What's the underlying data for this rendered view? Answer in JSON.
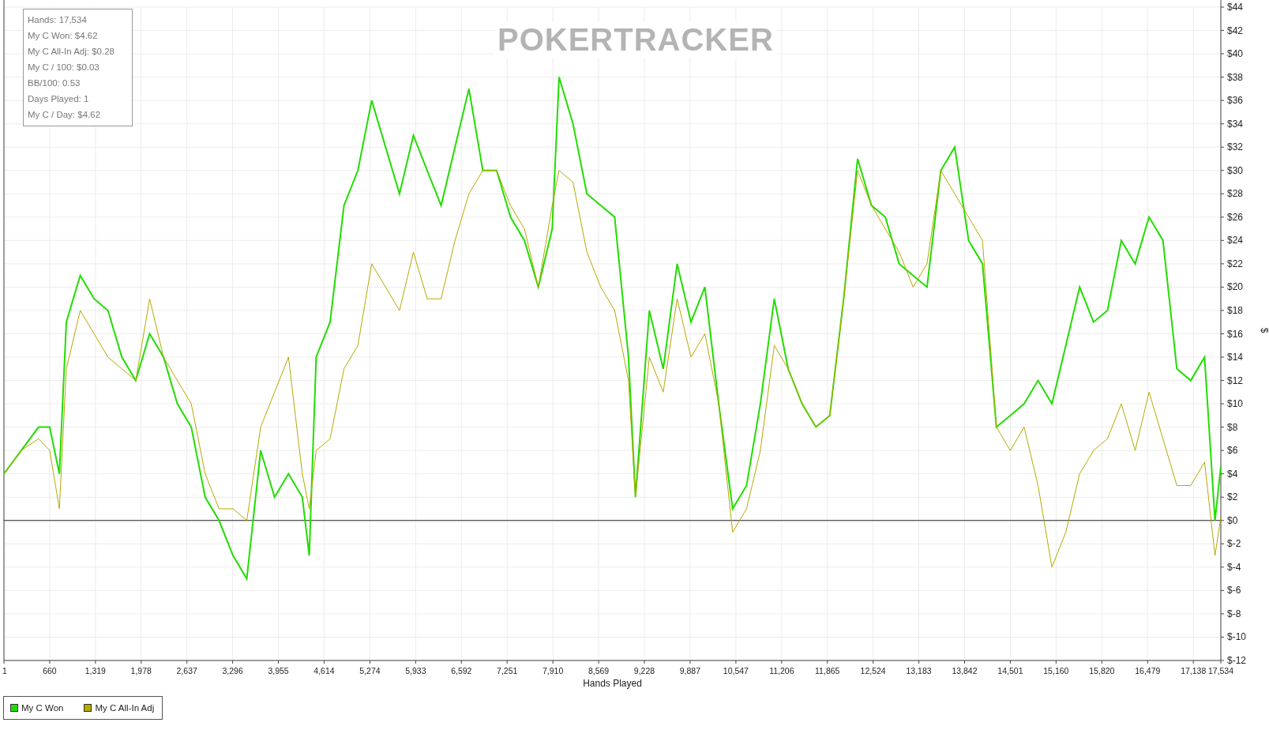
{
  "watermark": "POKERTRACKER",
  "stats_box": [
    "Hands: 17,534",
    "My C Won: $4.62",
    "My C All-In Adj: $0.28",
    "My C / 100: $0.03",
    "BB/100: 0.53",
    "Days Played: 1",
    "My C / Day: $4.62"
  ],
  "chart_data": {
    "type": "line",
    "grid": true,
    "xlabel": "Hands Played",
    "ylabel": "$",
    "x": [
      1,
      250,
      500,
      660,
      800,
      900,
      1100,
      1300,
      1500,
      1700,
      1900,
      2100,
      2300,
      2500,
      2700,
      2900,
      3100,
      3300,
      3500,
      3700,
      3900,
      4100,
      4300,
      4400,
      4500,
      4700,
      4900,
      5100,
      5300,
      5500,
      5700,
      5900,
      6100,
      6300,
      6500,
      6700,
      6900,
      7100,
      7300,
      7500,
      7700,
      7900,
      8000,
      8200,
      8400,
      8600,
      8800,
      9000,
      9100,
      9300,
      9500,
      9700,
      9900,
      10100,
      10300,
      10500,
      10700,
      10900,
      11100,
      11300,
      11500,
      11700,
      11900,
      12100,
      12300,
      12500,
      12700,
      12900,
      13100,
      13300,
      13500,
      13700,
      13900,
      14100,
      14300,
      14500,
      14700,
      14900,
      15100,
      15300,
      15500,
      15700,
      15900,
      16100,
      16300,
      16500,
      16700,
      16900,
      17100,
      17300,
      17450,
      17534
    ],
    "series": [
      {
        "name": "My C Won",
        "color": "#22dd00",
        "values": [
          4,
          6,
          8,
          8,
          4,
          17,
          21,
          19,
          18,
          14,
          12,
          16,
          14,
          10,
          8,
          2,
          0,
          -3,
          -5,
          6,
          2,
          4,
          2,
          -3,
          14,
          17,
          27,
          30,
          36,
          32,
          28,
          33,
          30,
          27,
          32,
          37,
          30,
          30,
          26,
          24,
          20,
          25,
          38,
          34,
          28,
          27,
          26,
          14,
          2,
          18,
          13,
          22,
          17,
          20,
          10,
          1,
          3,
          10,
          19,
          13,
          10,
          8,
          9,
          19,
          31,
          27,
          26,
          22,
          21,
          20,
          30,
          32,
          24,
          22,
          8,
          9,
          10,
          12,
          10,
          15,
          20,
          17,
          18,
          24,
          22,
          26,
          24,
          13,
          12,
          14,
          0,
          4.62
        ]
      },
      {
        "name": "My C All-In Adj",
        "color": "#b8a800",
        "values": [
          4,
          6,
          7,
          6,
          1,
          13,
          18,
          16,
          14,
          13,
          12,
          19,
          14,
          12,
          10,
          4,
          1,
          1,
          0,
          8,
          11,
          14,
          4,
          1,
          6,
          7,
          13,
          15,
          22,
          20,
          18,
          23,
          19,
          19,
          24,
          28,
          30,
          30,
          27,
          25,
          20,
          27,
          30,
          29,
          23,
          20,
          18,
          12,
          2,
          14,
          11,
          19,
          14,
          16,
          10,
          -1,
          1,
          6,
          15,
          13,
          10,
          8,
          9,
          19,
          30,
          27,
          25,
          23,
          20,
          22,
          30,
          28,
          26,
          24,
          8,
          6,
          8,
          3,
          -4,
          -1,
          4,
          6,
          7,
          10,
          6,
          11,
          7,
          3,
          3,
          5,
          -3,
          0.28
        ]
      }
    ],
    "xlim": [
      1,
      17534
    ],
    "ylim": [
      -12,
      44
    ],
    "xticks": [
      1,
      660,
      {
        "value": 1319,
        "label": "1,319"
      },
      {
        "value": 1978,
        "label": "1,978"
      },
      {
        "value": 2637,
        "label": "2,637"
      },
      {
        "value": 3296,
        "label": "3,296"
      },
      {
        "value": 3955,
        "label": "3,955"
      },
      {
        "value": 4614,
        "label": "4,614"
      },
      {
        "value": 5274,
        "label": "5,274"
      },
      {
        "value": 5933,
        "label": "5,933"
      },
      {
        "value": 6592,
        "label": "6,592"
      },
      {
        "value": 7251,
        "label": "7,251"
      },
      {
        "value": 7910,
        "label": "7,910"
      },
      {
        "value": 8569,
        "label": "8,569"
      },
      {
        "value": 9228,
        "label": "9,228"
      },
      {
        "value": 9887,
        "label": "9,887"
      },
      {
        "value": 10547,
        "label": "10,547"
      },
      {
        "value": 11206,
        "label": "11,206"
      },
      {
        "value": 11865,
        "label": "11,865"
      },
      {
        "value": 12524,
        "label": "12,524"
      },
      {
        "value": 13183,
        "label": "13,183"
      },
      {
        "value": 13842,
        "label": "13,842"
      },
      {
        "value": 14501,
        "label": "14,501"
      },
      {
        "value": 15160,
        "label": "15,160"
      },
      {
        "value": 15820,
        "label": "15,820"
      },
      {
        "value": 16479,
        "label": "16,479"
      },
      {
        "value": 17138,
        "label": "17,138"
      },
      {
        "value": 17534,
        "label": "17,534"
      }
    ],
    "yticks": [
      {
        "value": -12,
        "label": "$-12"
      },
      {
        "value": -10,
        "label": "$-10"
      },
      {
        "value": -8,
        "label": "$-8"
      },
      {
        "value": -6,
        "label": "$-6"
      },
      {
        "value": -4,
        "label": "$-4"
      },
      {
        "value": -2,
        "label": "$-2"
      },
      {
        "value": 0,
        "label": "$0"
      },
      {
        "value": 2,
        "label": "$2"
      },
      {
        "value": 4,
        "label": "$4"
      },
      {
        "value": 6,
        "label": "$6"
      },
      {
        "value": 8,
        "label": "$8"
      },
      {
        "value": 10,
        "label": "$10"
      },
      {
        "value": 12,
        "label": "$12"
      },
      {
        "value": 14,
        "label": "$14"
      },
      {
        "value": 16,
        "label": "$16"
      },
      {
        "value": 18,
        "label": "$18"
      },
      {
        "value": 20,
        "label": "$20"
      },
      {
        "value": 22,
        "label": "$22"
      },
      {
        "value": 24,
        "label": "$24"
      },
      {
        "value": 26,
        "label": "$26"
      },
      {
        "value": 28,
        "label": "$28"
      },
      {
        "value": 30,
        "label": "$30"
      },
      {
        "value": 32,
        "label": "$32"
      },
      {
        "value": 34,
        "label": "$34"
      },
      {
        "value": 36,
        "label": "$36"
      },
      {
        "value": 38,
        "label": "$38"
      },
      {
        "value": 40,
        "label": "$40"
      },
      {
        "value": 42,
        "label": "$42"
      },
      {
        "value": 44,
        "label": "$44"
      }
    ]
  }
}
